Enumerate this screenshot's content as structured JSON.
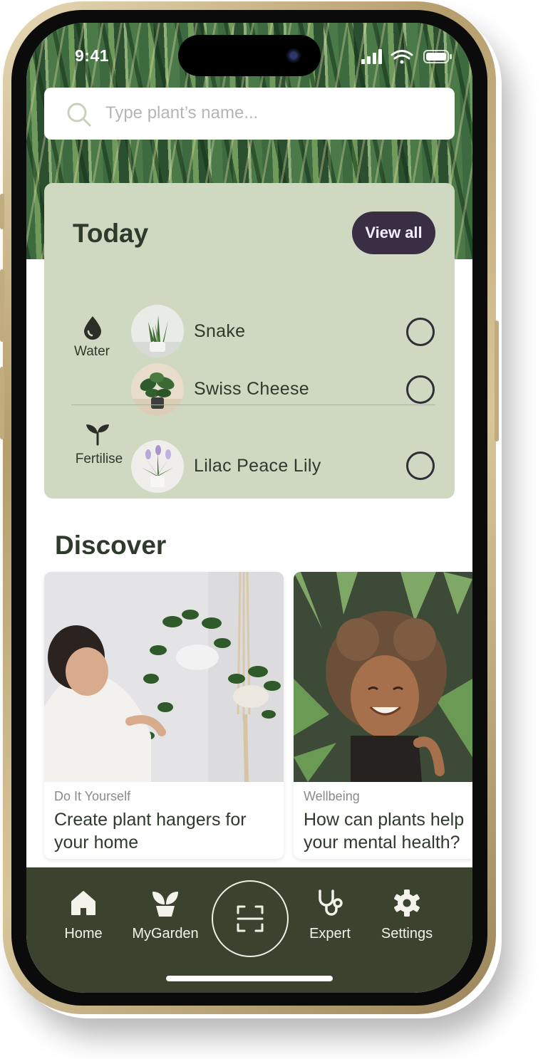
{
  "status_bar": {
    "time": "9:41"
  },
  "search": {
    "placeholder": "Type plant’s name..."
  },
  "today": {
    "title": "Today",
    "view_all_label": "View all",
    "groups": [
      {
        "label": "Water",
        "icon": "water-drop-icon",
        "plants": [
          {
            "name": "Snake"
          },
          {
            "name": "Swiss Cheese"
          }
        ]
      },
      {
        "label": "Fertilise",
        "icon": "sprout-icon",
        "plants": [
          {
            "name": "Lilac Peace Lily"
          }
        ]
      }
    ]
  },
  "discover": {
    "title": "Discover",
    "articles": [
      {
        "category": "Do It Yourself",
        "title_line1": "Create plant hangers for",
        "title_line2": "your home"
      },
      {
        "category": "Wellbeing",
        "title_line1": "How can plants help",
        "title_line2": "your mental health?"
      }
    ]
  },
  "nav": {
    "items": [
      {
        "label": "Home",
        "icon": "home-icon"
      },
      {
        "label": "MyGarden",
        "icon": "potted-plant-icon"
      },
      {
        "label": "",
        "icon": "scan-icon"
      },
      {
        "label": "Expert",
        "icon": "stethoscope-icon"
      },
      {
        "label": "Settings",
        "icon": "gear-icon"
      }
    ]
  },
  "colors": {
    "card_bg": "#cfd9c1",
    "accent_dark": "#3a2e45",
    "nav_bg": "#3b432e",
    "text_dark": "#2e3a2b"
  }
}
